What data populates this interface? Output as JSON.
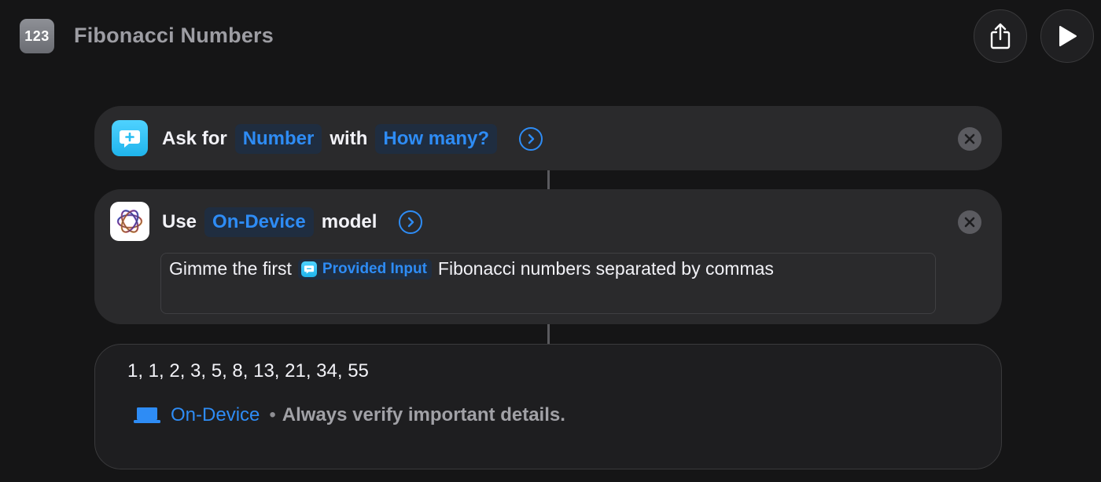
{
  "header": {
    "app_icon_text": "123",
    "title": "Fibonacci Numbers"
  },
  "actions": {
    "ask": {
      "prefix": "Ask for",
      "type_token": "Number",
      "middle": "with",
      "prompt_token": "How many?"
    },
    "use": {
      "prefix": "Use",
      "model_token": "On-Device",
      "suffix": "model",
      "prompt_before": "Gimme the first",
      "input_token": "Provided Input",
      "prompt_after": "Fibonacci numbers separated by commas"
    }
  },
  "result": {
    "output": "1, 1, 2, 3, 5, 8, 13, 21, 34, 55",
    "device_label": "On-Device",
    "separator": "•",
    "note": "Always verify important details."
  },
  "icons": {
    "app": "number-app-icon",
    "share": "share-icon",
    "play": "play-icon",
    "ask": "ask-speech-bubble-icon",
    "model": "apple-intelligence-icon",
    "chevron": "chevron-right-circle-icon",
    "close": "close-icon",
    "device": "laptop-icon"
  },
  "colors": {
    "accent": "#2e8cf5",
    "background": "#151516",
    "card": "#2a2a2c",
    "ask_icon": "#2fc2f5"
  }
}
